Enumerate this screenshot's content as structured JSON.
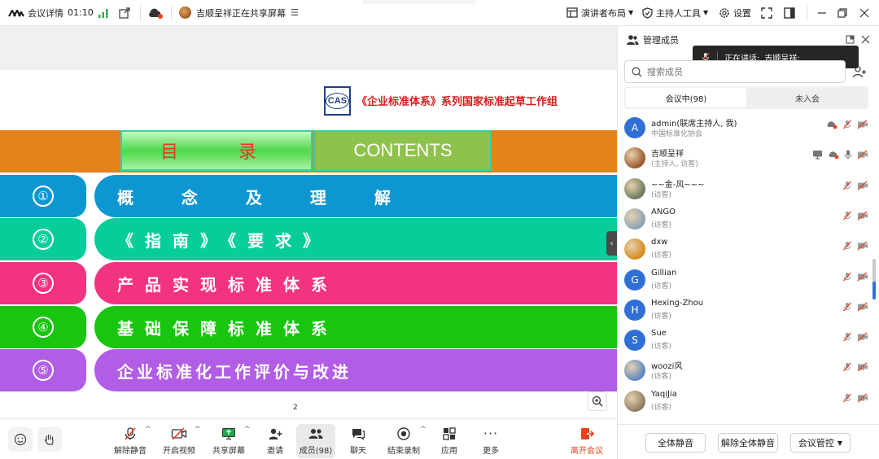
{
  "topbar": {
    "meeting_details": "会议详情",
    "timer": "01:10",
    "sharing_status": "吉顺呈祥正在共享屏幕",
    "presenter_layout": "演讲者布局",
    "host_tools": "主持人工具",
    "settings": "设置"
  },
  "slide": {
    "logo_text": "CAS",
    "header_title": "《企业标准体系》系列国家标准起草工作组",
    "toc_cn": "目  录",
    "toc_en": "CONTENTS",
    "page_number": "2",
    "colors": {
      "orange": "#e4821b",
      "blue": "#0e96d0",
      "teal": "#07cd9a",
      "pink": "#f23380",
      "green": "#18c50f",
      "purple": "#b15de6"
    },
    "items": [
      {
        "num": "①",
        "label": "概 念 及 理 解",
        "color": "#0e96d0"
      },
      {
        "num": "②",
        "label": "《指南》《要求》",
        "color": "#07cd9a"
      },
      {
        "num": "③",
        "label": "产品实现标准体系",
        "color": "#f23380"
      },
      {
        "num": "④",
        "label": "基础保障标准体系",
        "color": "#18c50f"
      },
      {
        "num": "⑤",
        "label": "企业标准化工作评价与改进",
        "color": "#b15de6"
      }
    ]
  },
  "controls": {
    "unmute": "解除静音",
    "start_video": "开启视频",
    "share_screen": "共享屏幕",
    "invite": "邀请",
    "members": "成员(98)",
    "chat": "聊天",
    "end_recording": "结束录制",
    "apps": "应用",
    "more": "更多",
    "leave": "离开会议",
    "leave_color": "#e8421b"
  },
  "panel": {
    "title": "管理成员",
    "search_placeholder": "搜索成员",
    "tab_in_meeting": "会议中(98)",
    "tab_not_joined": "未入会",
    "speaking_prefix": "正在讲话:",
    "speaking_name": "吉顺呈祥;",
    "members": [
      {
        "initial": "A",
        "name": "admin(联席主持人, 我)",
        "role": "中国标准化协会",
        "avatar_color": "#2f6fd6"
      },
      {
        "initial": "",
        "name": "吉顺呈祥",
        "role": "(主持人, 访客)",
        "avatar_color": "#9a5a2a"
      },
      {
        "initial": "",
        "name": "~~金-风~~~",
        "role": "(访客)",
        "avatar_color": "#6b7a5e"
      },
      {
        "initial": "",
        "name": "ANGO",
        "role": "(访客)",
        "avatar_color": "#8ca0b3"
      },
      {
        "initial": "",
        "name": "dxw",
        "role": "(访客)",
        "avatar_color": "#d78a1c"
      },
      {
        "initial": "G",
        "name": "Gillian",
        "role": "(访客)",
        "avatar_color": "#2f6fd6"
      },
      {
        "initial": "H",
        "name": "Hexing-Zhou",
        "role": "(访客)",
        "avatar_color": "#2f6fd6"
      },
      {
        "initial": "S",
        "name": "Sue",
        "role": "(访客)",
        "avatar_color": "#2f6fd6"
      },
      {
        "initial": "",
        "name": "woozi风",
        "role": "(访客)",
        "avatar_color": "#5b86c2"
      },
      {
        "initial": "",
        "name": "YaqiJia",
        "role": "(访客)",
        "avatar_color": "#8f7a60"
      }
    ],
    "btn_mute_all": "全体静音",
    "btn_unmute_all": "解除全体静音",
    "btn_meeting_control": "会议管控"
  }
}
